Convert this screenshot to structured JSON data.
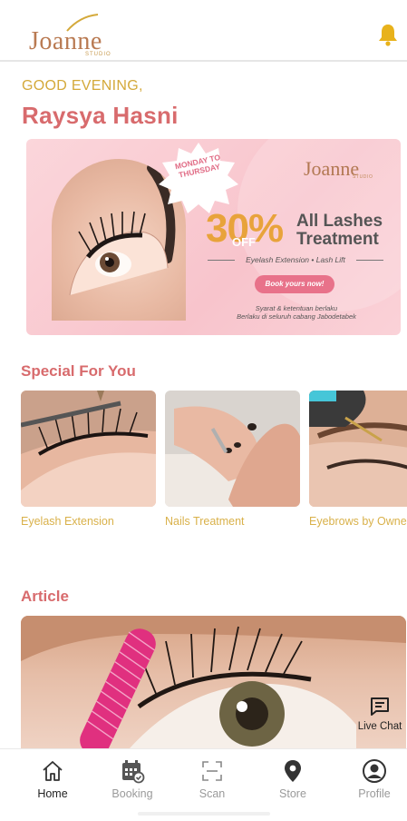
{
  "header": {
    "logo_word": "Joanne",
    "logo_sub": "STUDIO",
    "bell_icon": "bell-icon",
    "accent": "#e8b21b"
  },
  "greeting": "GOOD EVENING,",
  "user_name": "Raysya Hasni",
  "banner": {
    "badge": "MONDAY TO THURSDAY",
    "logo": "Joanne",
    "logo_sub": "STUDIO",
    "percent": "30%",
    "off": "OFF",
    "title_line1": "All Lashes",
    "title_line2": "Treatment",
    "services": "Eyelash Extension • Lash Lift",
    "cta": "Book yours now!",
    "terms_line1": "Syarat & ketentuan berlaku",
    "terms_line2": "Berlaku di seluruh cabang Jabodetabek"
  },
  "special": {
    "title": "Special For You",
    "items": [
      {
        "label": "Eyelash Extension"
      },
      {
        "label": "Nails Treatment"
      },
      {
        "label": "Eyebrows by Owner"
      }
    ]
  },
  "article": {
    "title": "Article"
  },
  "live_chat": {
    "label": "Live Chat",
    "icon": "chat-icon"
  },
  "nav": {
    "items": [
      {
        "label": "Home",
        "icon": "home-icon",
        "active": true
      },
      {
        "label": "Booking",
        "icon": "calendar-icon",
        "active": false
      },
      {
        "label": "Scan",
        "icon": "scan-icon",
        "active": false
      },
      {
        "label": "Store",
        "icon": "location-pin-icon",
        "active": false
      },
      {
        "label": "Profile",
        "icon": "profile-icon",
        "active": false
      }
    ]
  },
  "colors": {
    "brand_pink": "#d86b6d",
    "brand_gold": "#d4a93a",
    "label_gold": "#d9b14a"
  }
}
